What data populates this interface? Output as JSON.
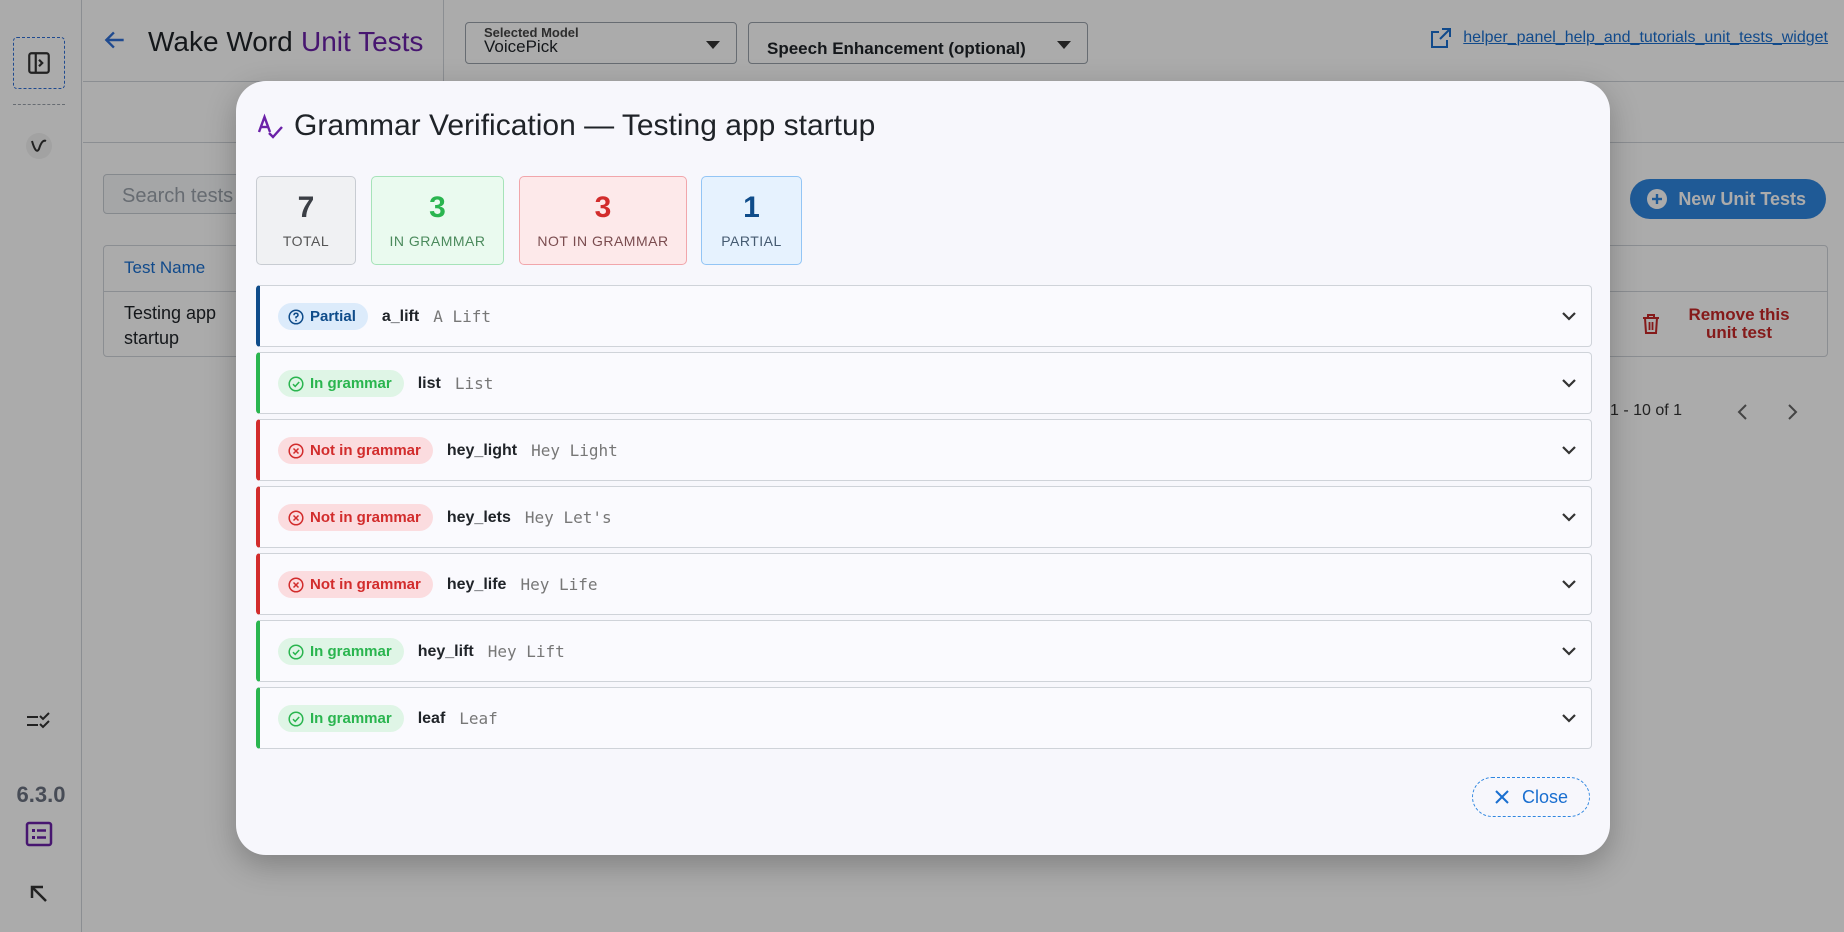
{
  "app": {
    "version": "6.3.0",
    "title_prefix": "Wake Word",
    "title_suffix": "Unit Tests",
    "help_link": "helper_panel_help_and_tutorials_unit_tests_widget"
  },
  "selects": {
    "model_label": "Selected Model",
    "model_value": "VoicePick",
    "enhancement_value": "Speech Enhancement (optional)"
  },
  "list_view": {
    "search_placeholder": "Search tests",
    "new_button": "New Unit Tests",
    "column_test_name": "Test Name",
    "row_name": "Testing app startup",
    "remove_label": "Remove this unit test",
    "pagination": "1 - 10 of 1"
  },
  "modal": {
    "title": "Grammar Verification — Testing app startup",
    "stats": {
      "total": {
        "value": "7",
        "label": "TOTAL"
      },
      "in_grammar": {
        "value": "3",
        "label": "IN GRAMMAR"
      },
      "not_in_grammar": {
        "value": "3",
        "label": "NOT IN GRAMMAR"
      },
      "partial": {
        "value": "1",
        "label": "PARTIAL"
      }
    },
    "rows": [
      {
        "status": "Partial",
        "key": "a_lift",
        "phrase": "A Lift"
      },
      {
        "status": "In grammar",
        "key": "list",
        "phrase": "List"
      },
      {
        "status": "Not in grammar",
        "key": "hey_light",
        "phrase": "Hey Light"
      },
      {
        "status": "Not in grammar",
        "key": "hey_lets",
        "phrase": "Hey Let's"
      },
      {
        "status": "Not in grammar",
        "key": "hey_life",
        "phrase": "Hey Life"
      },
      {
        "status": "In grammar",
        "key": "hey_lift",
        "phrase": "Hey Lift"
      },
      {
        "status": "In grammar",
        "key": "leaf",
        "phrase": "Leaf"
      }
    ],
    "close_label": "Close"
  },
  "colors": {
    "partial": "#0f4c8a",
    "in_grammar": "#2ab54f",
    "not_in_grammar": "#d22c2c",
    "accent": "#2f86e0",
    "brand_purple": "#6b21a8"
  }
}
